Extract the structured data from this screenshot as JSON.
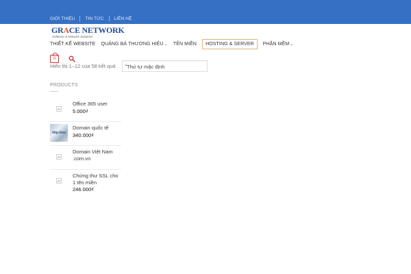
{
  "topbar": {
    "links": [
      "GIỚI THIỆU",
      "TIN TỨC",
      "LIÊN HỆ"
    ]
  },
  "logo": {
    "name_part1": "GR",
    "name_accent": "A",
    "name_part2": "CE NETWORK",
    "tagline": "Software & Network Solutions"
  },
  "mainnav": {
    "items": [
      {
        "label": "THIẾT KẾ WEBSITE",
        "has_dropdown": false
      },
      {
        "label": "QUẢNG BÁ THƯƠNG HIỆU",
        "has_dropdown": true
      },
      {
        "label": "TÊN MIỀN",
        "has_dropdown": false
      },
      {
        "label": "HOSTING & SERVER",
        "has_dropdown": false
      },
      {
        "label": "PHẦN MỀM",
        "has_dropdown": true
      }
    ]
  },
  "cart": {
    "count": "0"
  },
  "shop": {
    "results_text": "Hiển thị 1–12 của 58 kết quả",
    "sort_selected": "Thứ tự mặc định"
  },
  "widget": {
    "title": "PRODUCTS",
    "products": [
      {
        "name": "Office 365 user",
        "price": "5.000₫",
        "thumb": "placeholder"
      },
      {
        "name": "Domain quốc tế",
        "price": "340.000₫",
        "thumb": "image",
        "thumb_text": "http://ww"
      },
      {
        "name": "Domain Việt Nam .com.vn",
        "price": "",
        "thumb": "placeholder"
      },
      {
        "name": "Chứng thư SSL cho 1 tên miền",
        "price": "246.000₫",
        "thumb": "placeholder"
      }
    ]
  },
  "colors": {
    "topbar": "#3570c4",
    "accent_red": "#cc3333",
    "hosting_border": "#e2b27a"
  }
}
